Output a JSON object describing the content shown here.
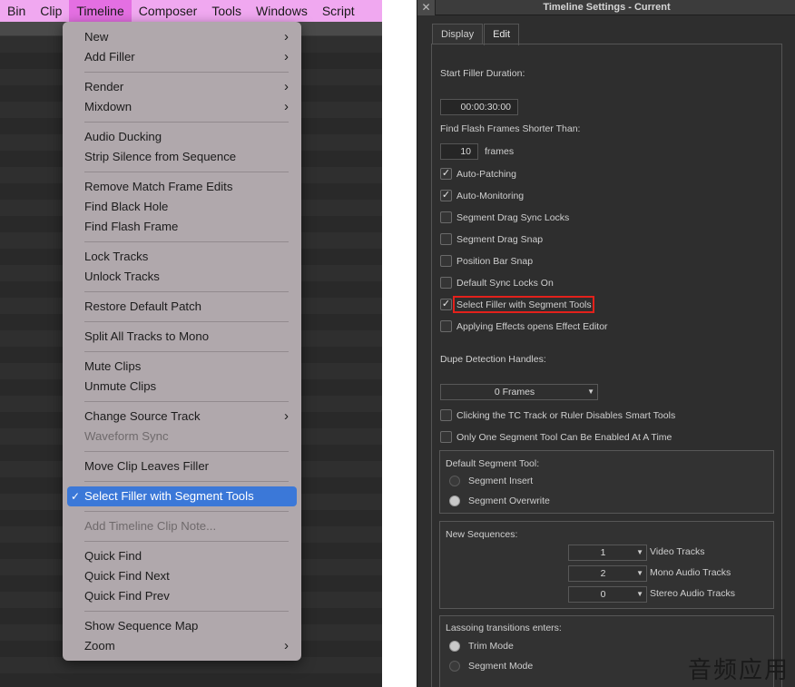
{
  "menubar": {
    "items": [
      "Bin",
      "Clip",
      "Timeline",
      "Composer",
      "Tools",
      "Windows",
      "Script"
    ],
    "active": "Timeline"
  },
  "timeline_menu": {
    "items": [
      {
        "label": "New",
        "submenu": true
      },
      {
        "label": "Add Filler",
        "submenu": true
      },
      {
        "label": "Render",
        "submenu": true
      },
      {
        "label": "Mixdown",
        "submenu": true
      },
      {
        "label": "Audio Ducking"
      },
      {
        "label": "Strip Silence from Sequence"
      },
      {
        "label": "Remove Match Frame Edits"
      },
      {
        "label": "Find Black Hole"
      },
      {
        "label": "Find Flash Frame"
      },
      {
        "label": "Lock Tracks"
      },
      {
        "label": "Unlock Tracks"
      },
      {
        "label": "Restore Default Patch"
      },
      {
        "label": "Split All Tracks to Mono"
      },
      {
        "label": "Mute Clips"
      },
      {
        "label": "Unmute Clips"
      },
      {
        "label": "Change Source Track",
        "submenu": true
      },
      {
        "label": "Waveform Sync",
        "disabled": true
      },
      {
        "label": "Move Clip Leaves Filler"
      },
      {
        "label": "Select Filler with Segment Tools",
        "checked": true,
        "selected": true
      },
      {
        "label": "Add Timeline Clip Note...",
        "disabled": true
      },
      {
        "label": "Quick Find"
      },
      {
        "label": "Quick Find Next"
      },
      {
        "label": "Quick Find Prev"
      },
      {
        "label": "Show Sequence Map"
      },
      {
        "label": "Zoom",
        "submenu": true
      }
    ],
    "check_glyph": "✓",
    "submenu_glyph": "›"
  },
  "dialog": {
    "title": "Timeline Settings - Current",
    "close_glyph": "✕",
    "tabs": [
      "Display",
      "Edit"
    ],
    "active_tab": "Edit",
    "start_filler_label": "Start Filler Duration:",
    "start_filler_value": "00:00:30:00",
    "flash_frames_label": "Find Flash Frames Shorter Than:",
    "flash_frames_value": "10",
    "flash_frames_unit": "frames",
    "checkboxes": [
      {
        "label": "Auto-Patching",
        "checked": true
      },
      {
        "label": "Auto-Monitoring",
        "checked": true
      },
      {
        "label": "Segment Drag Sync Locks",
        "checked": false
      },
      {
        "label": "Segment Drag Snap",
        "checked": false
      },
      {
        "label": "Position Bar Snap",
        "checked": false
      },
      {
        "label": "Default Sync Locks On",
        "checked": false
      },
      {
        "label": "Select Filler with Segment Tools",
        "checked": true,
        "highlighted": true
      },
      {
        "label": "Applying Effects opens Effect Editor",
        "checked": false
      }
    ],
    "dupe_label": "Dupe Detection Handles:",
    "dupe_value": "0 Frames",
    "smart_tools_label": "Clicking the TC Track or Ruler Disables Smart Tools",
    "smart_tools_checked": false,
    "one_segment_label": "Only One Segment Tool Can Be Enabled At A Time",
    "one_segment_checked": false,
    "default_segment": {
      "label": "Default Segment Tool:",
      "options": [
        {
          "label": "Segment Insert",
          "selected": false
        },
        {
          "label": "Segment Overwrite",
          "selected": true
        }
      ]
    },
    "new_sequences": {
      "label": "New Sequences:",
      "rows": [
        {
          "value": "1",
          "label": "Video Tracks"
        },
        {
          "value": "2",
          "label": "Mono Audio Tracks"
        },
        {
          "value": "0",
          "label": "Stereo Audio Tracks"
        }
      ]
    },
    "lassoing": {
      "label": "Lassoing transitions enters:",
      "options": [
        {
          "label": "Trim Mode",
          "selected": true
        },
        {
          "label": "Segment Mode",
          "selected": false
        }
      ]
    },
    "dropdown_arrow": "▼"
  },
  "watermark": "音频应用"
}
